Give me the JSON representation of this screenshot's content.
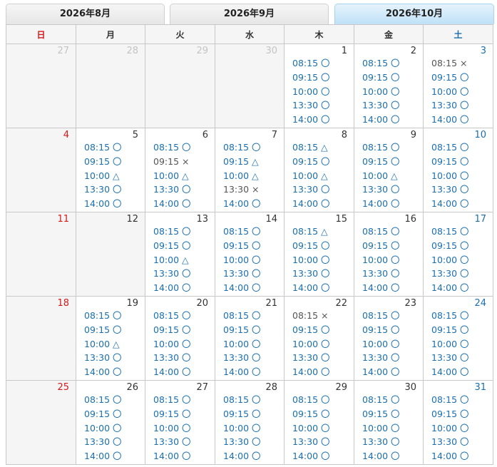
{
  "tabs": [
    {
      "label": "2026年8月",
      "active": false
    },
    {
      "label": "2026年9月",
      "active": false
    },
    {
      "label": "2026年10月",
      "active": true
    }
  ],
  "weekdays": [
    "日",
    "月",
    "火",
    "水",
    "木",
    "金",
    "土"
  ],
  "weeks": [
    [
      {
        "day": "27",
        "state": "past"
      },
      {
        "day": "28",
        "state": "past"
      },
      {
        "day": "29",
        "state": "past"
      },
      {
        "day": "30",
        "state": "past"
      },
      {
        "day": "1",
        "slots": [
          {
            "time": "08:15",
            "mark": "〇"
          },
          {
            "time": "09:15",
            "mark": "〇"
          },
          {
            "time": "10:00",
            "mark": "〇"
          },
          {
            "time": "13:30",
            "mark": "〇"
          },
          {
            "time": "14:00",
            "mark": "〇"
          }
        ]
      },
      {
        "day": "2",
        "slots": [
          {
            "time": "08:15",
            "mark": "〇"
          },
          {
            "time": "09:15",
            "mark": "〇"
          },
          {
            "time": "10:00",
            "mark": "〇"
          },
          {
            "time": "13:30",
            "mark": "〇"
          },
          {
            "time": "14:00",
            "mark": "〇"
          }
        ]
      },
      {
        "day": "3",
        "slots": [
          {
            "time": "08:15",
            "mark": "×"
          },
          {
            "time": "09:15",
            "mark": "〇"
          },
          {
            "time": "10:00",
            "mark": "〇"
          },
          {
            "time": "13:30",
            "mark": "〇"
          },
          {
            "time": "14:00",
            "mark": "〇"
          }
        ]
      }
    ],
    [
      {
        "day": "4",
        "state": "closed"
      },
      {
        "day": "5",
        "slots": [
          {
            "time": "08:15",
            "mark": "〇"
          },
          {
            "time": "09:15",
            "mark": "〇"
          },
          {
            "time": "10:00",
            "mark": "△"
          },
          {
            "time": "13:30",
            "mark": "〇"
          },
          {
            "time": "14:00",
            "mark": "〇"
          }
        ]
      },
      {
        "day": "6",
        "slots": [
          {
            "time": "08:15",
            "mark": "〇"
          },
          {
            "time": "09:15",
            "mark": "×"
          },
          {
            "time": "10:00",
            "mark": "△"
          },
          {
            "time": "13:30",
            "mark": "〇"
          },
          {
            "time": "14:00",
            "mark": "〇"
          }
        ]
      },
      {
        "day": "7",
        "slots": [
          {
            "time": "08:15",
            "mark": "〇"
          },
          {
            "time": "09:15",
            "mark": "△"
          },
          {
            "time": "10:00",
            "mark": "△"
          },
          {
            "time": "13:30",
            "mark": "×"
          },
          {
            "time": "14:00",
            "mark": "〇"
          }
        ]
      },
      {
        "day": "8",
        "slots": [
          {
            "time": "08:15",
            "mark": "△"
          },
          {
            "time": "09:15",
            "mark": "〇"
          },
          {
            "time": "10:00",
            "mark": "△"
          },
          {
            "time": "13:30",
            "mark": "〇"
          },
          {
            "time": "14:00",
            "mark": "〇"
          }
        ]
      },
      {
        "day": "9",
        "slots": [
          {
            "time": "08:15",
            "mark": "〇"
          },
          {
            "time": "09:15",
            "mark": "〇"
          },
          {
            "time": "10:00",
            "mark": "△"
          },
          {
            "time": "13:30",
            "mark": "〇"
          },
          {
            "time": "14:00",
            "mark": "〇"
          }
        ]
      },
      {
        "day": "10",
        "slots": [
          {
            "time": "08:15",
            "mark": "〇"
          },
          {
            "time": "09:15",
            "mark": "〇"
          },
          {
            "time": "10:00",
            "mark": "〇"
          },
          {
            "time": "13:30",
            "mark": "〇"
          },
          {
            "time": "14:00",
            "mark": "〇"
          }
        ]
      }
    ],
    [
      {
        "day": "11",
        "state": "closed"
      },
      {
        "day": "12",
        "state": "closed"
      },
      {
        "day": "13",
        "slots": [
          {
            "time": "08:15",
            "mark": "〇"
          },
          {
            "time": "09:15",
            "mark": "〇"
          },
          {
            "time": "10:00",
            "mark": "△"
          },
          {
            "time": "13:30",
            "mark": "〇"
          },
          {
            "time": "14:00",
            "mark": "〇"
          }
        ]
      },
      {
        "day": "14",
        "slots": [
          {
            "time": "08:15",
            "mark": "〇"
          },
          {
            "time": "09:15",
            "mark": "〇"
          },
          {
            "time": "10:00",
            "mark": "〇"
          },
          {
            "time": "13:30",
            "mark": "〇"
          },
          {
            "time": "14:00",
            "mark": "〇"
          }
        ]
      },
      {
        "day": "15",
        "slots": [
          {
            "time": "08:15",
            "mark": "△"
          },
          {
            "time": "09:15",
            "mark": "〇"
          },
          {
            "time": "10:00",
            "mark": "〇"
          },
          {
            "time": "13:30",
            "mark": "〇"
          },
          {
            "time": "14:00",
            "mark": "〇"
          }
        ]
      },
      {
        "day": "16",
        "slots": [
          {
            "time": "08:15",
            "mark": "〇"
          },
          {
            "time": "09:15",
            "mark": "〇"
          },
          {
            "time": "10:00",
            "mark": "〇"
          },
          {
            "time": "13:30",
            "mark": "〇"
          },
          {
            "time": "14:00",
            "mark": "〇"
          }
        ]
      },
      {
        "day": "17",
        "slots": [
          {
            "time": "08:15",
            "mark": "〇"
          },
          {
            "time": "09:15",
            "mark": "〇"
          },
          {
            "time": "10:00",
            "mark": "〇"
          },
          {
            "time": "13:30",
            "mark": "〇"
          },
          {
            "time": "14:00",
            "mark": "〇"
          }
        ]
      }
    ],
    [
      {
        "day": "18",
        "state": "closed"
      },
      {
        "day": "19",
        "slots": [
          {
            "time": "08:15",
            "mark": "〇"
          },
          {
            "time": "09:15",
            "mark": "〇"
          },
          {
            "time": "10:00",
            "mark": "△"
          },
          {
            "time": "13:30",
            "mark": "〇"
          },
          {
            "time": "14:00",
            "mark": "〇"
          }
        ]
      },
      {
        "day": "20",
        "slots": [
          {
            "time": "08:15",
            "mark": "〇"
          },
          {
            "time": "09:15",
            "mark": "〇"
          },
          {
            "time": "10:00",
            "mark": "〇"
          },
          {
            "time": "13:30",
            "mark": "〇"
          },
          {
            "time": "14:00",
            "mark": "〇"
          }
        ]
      },
      {
        "day": "21",
        "slots": [
          {
            "time": "08:15",
            "mark": "〇"
          },
          {
            "time": "09:15",
            "mark": "〇"
          },
          {
            "time": "10:00",
            "mark": "〇"
          },
          {
            "time": "13:30",
            "mark": "〇"
          },
          {
            "time": "14:00",
            "mark": "〇"
          }
        ]
      },
      {
        "day": "22",
        "slots": [
          {
            "time": "08:15",
            "mark": "×"
          },
          {
            "time": "09:15",
            "mark": "〇"
          },
          {
            "time": "10:00",
            "mark": "〇"
          },
          {
            "time": "13:30",
            "mark": "〇"
          },
          {
            "time": "14:00",
            "mark": "〇"
          }
        ]
      },
      {
        "day": "23",
        "slots": [
          {
            "time": "08:15",
            "mark": "〇"
          },
          {
            "time": "09:15",
            "mark": "〇"
          },
          {
            "time": "10:00",
            "mark": "〇"
          },
          {
            "time": "13:30",
            "mark": "〇"
          },
          {
            "time": "14:00",
            "mark": "〇"
          }
        ]
      },
      {
        "day": "24",
        "slots": [
          {
            "time": "08:15",
            "mark": "〇"
          },
          {
            "time": "09:15",
            "mark": "〇"
          },
          {
            "time": "10:00",
            "mark": "〇"
          },
          {
            "time": "13:30",
            "mark": "〇"
          },
          {
            "time": "14:00",
            "mark": "〇"
          }
        ]
      }
    ],
    [
      {
        "day": "25",
        "state": "closed"
      },
      {
        "day": "26",
        "slots": [
          {
            "time": "08:15",
            "mark": "〇"
          },
          {
            "time": "09:15",
            "mark": "〇"
          },
          {
            "time": "10:00",
            "mark": "〇"
          },
          {
            "time": "13:30",
            "mark": "〇"
          },
          {
            "time": "14:00",
            "mark": "〇"
          }
        ]
      },
      {
        "day": "27",
        "slots": [
          {
            "time": "08:15",
            "mark": "〇"
          },
          {
            "time": "09:15",
            "mark": "〇"
          },
          {
            "time": "10:00",
            "mark": "〇"
          },
          {
            "time": "13:30",
            "mark": "〇"
          },
          {
            "time": "14:00",
            "mark": "〇"
          }
        ]
      },
      {
        "day": "28",
        "slots": [
          {
            "time": "08:15",
            "mark": "〇"
          },
          {
            "time": "09:15",
            "mark": "〇"
          },
          {
            "time": "10:00",
            "mark": "〇"
          },
          {
            "time": "13:30",
            "mark": "〇"
          },
          {
            "time": "14:00",
            "mark": "〇"
          }
        ]
      },
      {
        "day": "29",
        "slots": [
          {
            "time": "08:15",
            "mark": "〇"
          },
          {
            "time": "09:15",
            "mark": "〇"
          },
          {
            "time": "10:00",
            "mark": "〇"
          },
          {
            "time": "13:30",
            "mark": "〇"
          },
          {
            "time": "14:00",
            "mark": "〇"
          }
        ]
      },
      {
        "day": "30",
        "slots": [
          {
            "time": "08:15",
            "mark": "〇"
          },
          {
            "time": "09:15",
            "mark": "〇"
          },
          {
            "time": "10:00",
            "mark": "〇"
          },
          {
            "time": "13:30",
            "mark": "〇"
          },
          {
            "time": "14:00",
            "mark": "〇"
          }
        ]
      },
      {
        "day": "31",
        "slots": [
          {
            "time": "08:15",
            "mark": "〇"
          },
          {
            "time": "09:15",
            "mark": "〇"
          },
          {
            "time": "10:00",
            "mark": "〇"
          },
          {
            "time": "13:30",
            "mark": "〇"
          },
          {
            "time": "14:00",
            "mark": "〇"
          }
        ]
      }
    ]
  ]
}
